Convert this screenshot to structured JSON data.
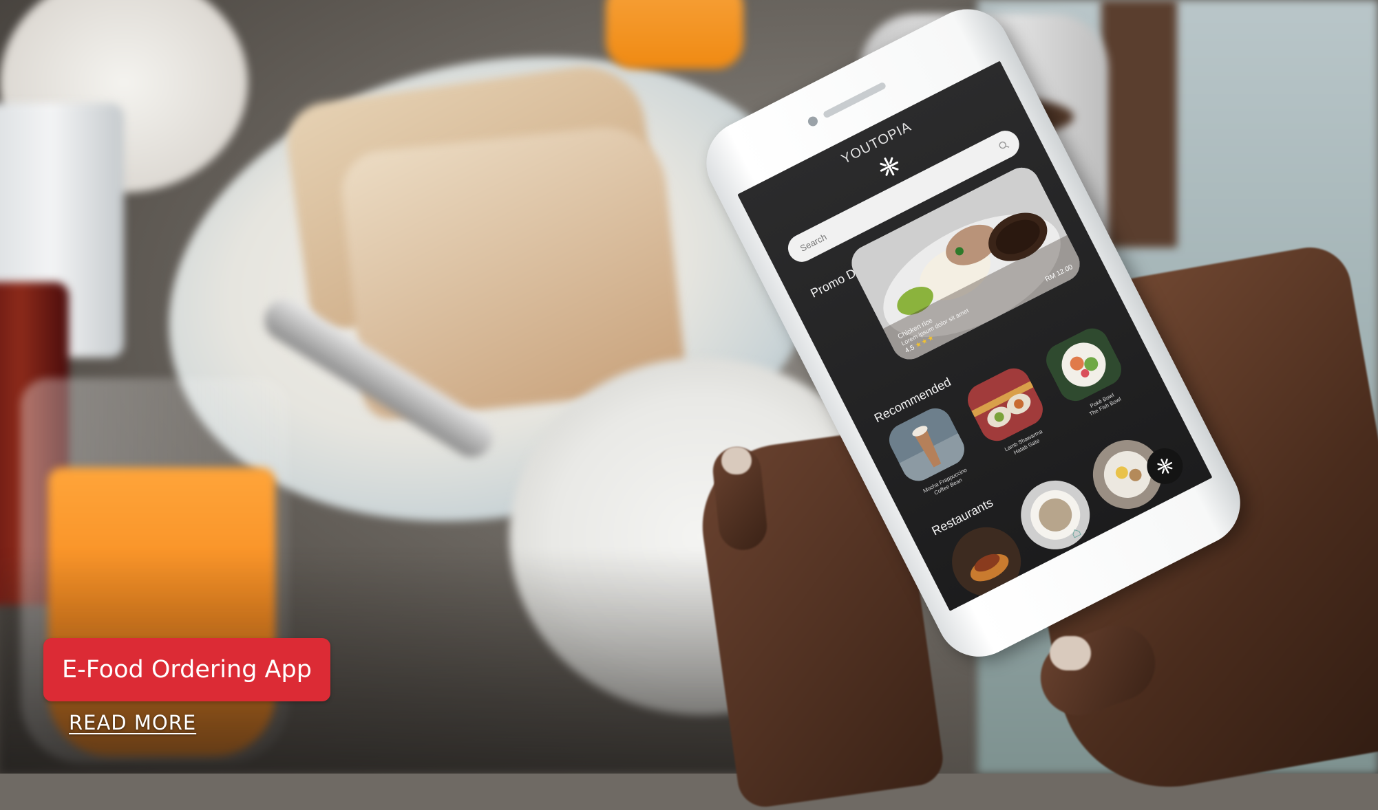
{
  "hero": {
    "title_button": "E-Food Ordering App",
    "read_more": "READ MORE",
    "accent_color": "#dc2b35"
  },
  "app": {
    "brand": "YOUTOPIA",
    "logo_icon": "youtopia-logo-icon",
    "search": {
      "placeholder": "Search",
      "icon": "search-icon"
    },
    "promo": {
      "section_label": "Promo Deals",
      "item_name": "Chicken rice",
      "item_desc": "Lorem ipsum dolor sit amet",
      "price": "RM 12.00",
      "rating_text": "4.5",
      "stars": "★★★",
      "stars_color": "#f2c230"
    },
    "recommended": {
      "section_label": "Recommended",
      "items": [
        {
          "line1": "Mocha Frappuccino",
          "line2": "Coffee Bean"
        },
        {
          "line1": "Lamb Shawarma",
          "line2": "Hatab Gate"
        },
        {
          "line1": "Pokè Bowl",
          "line2": "The Fish Bowl"
        }
      ]
    },
    "restaurants": {
      "section_label": "Restaurants"
    },
    "bottom_nav": {
      "home_icon": "home-icon",
      "fab_icon": "youtopia-logo-icon"
    }
  }
}
